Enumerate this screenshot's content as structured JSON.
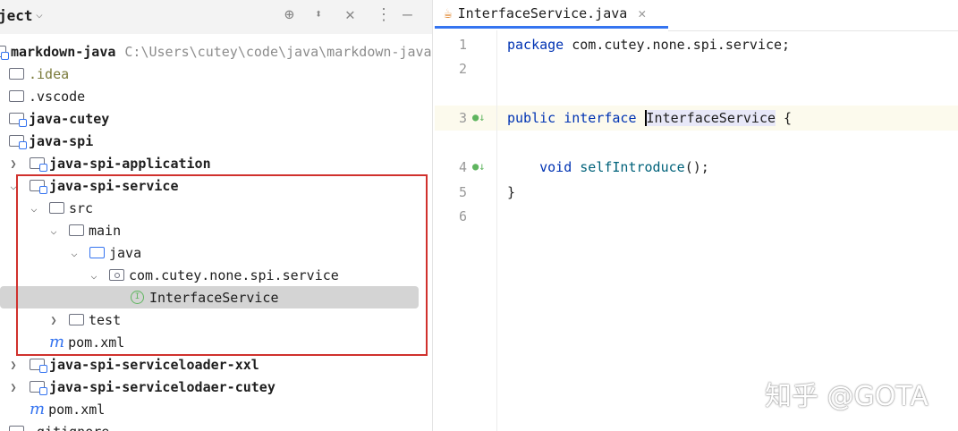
{
  "project_panel": {
    "title": "ject",
    "header_icons": [
      "locate-icon",
      "expand-collapse-icon",
      "close-icon",
      "more-icon",
      "minimize-icon"
    ],
    "tree": [
      {
        "label": "markdown-java",
        "path": "C:\\Users\\cutey\\code\\java\\markdown-java"
      },
      {
        "label": ".idea"
      },
      {
        "label": ".vscode"
      },
      {
        "label": "java-cutey"
      },
      {
        "label": "java-spi"
      },
      {
        "label": "java-spi-application"
      },
      {
        "label": "java-spi-service"
      },
      {
        "label": "src"
      },
      {
        "label": "main"
      },
      {
        "label": "java"
      },
      {
        "label": "com.cutey.none.spi.service"
      },
      {
        "label": "InterfaceService"
      },
      {
        "label": "test"
      },
      {
        "label": "pom.xml"
      },
      {
        "label": "java-spi-serviceloader-xxl"
      },
      {
        "label": "java-spi-servicelodaer-cutey"
      },
      {
        "label": "pom.xml"
      },
      {
        "label": ".gitignore"
      }
    ]
  },
  "editor": {
    "tab": "InterfaceService.java",
    "lines": {
      "n1": "1",
      "n2": "2",
      "n3": "3",
      "n4": "4",
      "n5": "5",
      "n6": "6",
      "l1_kw": "package",
      "l1_rest": " com.cutey.none.spi.service;",
      "l3_kw": "public interface ",
      "l3_name": "InterfaceService",
      "l3_rest": " {",
      "l4_kw": "    void ",
      "l4_fn": "selfIntroduce",
      "l4_rest": "();",
      "l5": "}"
    }
  },
  "watermark": "知乎 @GOTA"
}
